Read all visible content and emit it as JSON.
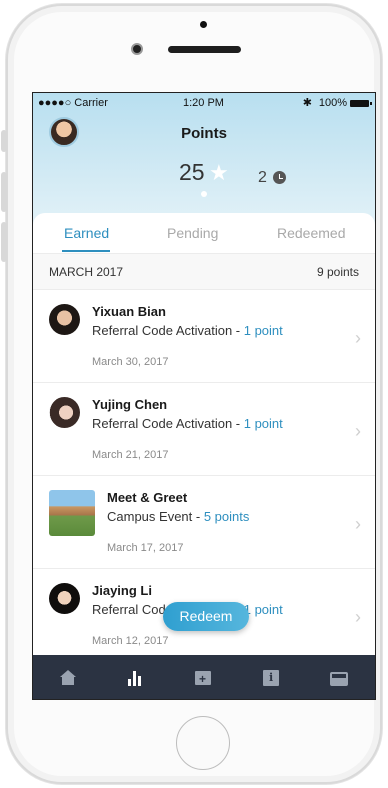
{
  "status": {
    "carrier": "●●●●○ Carrier",
    "time": "1:20 PM",
    "bluetooth": "✱",
    "battery": "100%"
  },
  "header": {
    "title": "Points",
    "earned": "25",
    "pending": "2"
  },
  "tabs": [
    {
      "label": "Earned"
    },
    {
      "label": "Pending"
    },
    {
      "label": "Redeemed"
    }
  ],
  "month": {
    "label": "MARCH 2017",
    "points": "9 points"
  },
  "items": [
    {
      "name": "Yixuan Bian",
      "desc": "Referral Code Activation - ",
      "points": "1 point",
      "date": "March 30, 2017"
    },
    {
      "name": "Yujing Chen",
      "desc": "Referral Code Activation - ",
      "points": "1 point",
      "date": "March 21, 2017"
    },
    {
      "name": "Meet & Greet",
      "desc": "Campus Event - ",
      "points": "5 points",
      "date": "March 17, 2017"
    },
    {
      "name": "Jiaying Li",
      "desc": "Referral Code Activation - ",
      "points": "1 point",
      "date": "March 12, 2017"
    }
  ],
  "redeem_label": "Redeem",
  "tabbar": [
    "home-icon",
    "bar-chart-icon",
    "calendar-add-icon",
    "info-book-icon",
    "inbox-icon"
  ],
  "colors": {
    "accent": "#2e8fbf",
    "tabbar": "#2b3342",
    "header": "#b8dff0"
  }
}
